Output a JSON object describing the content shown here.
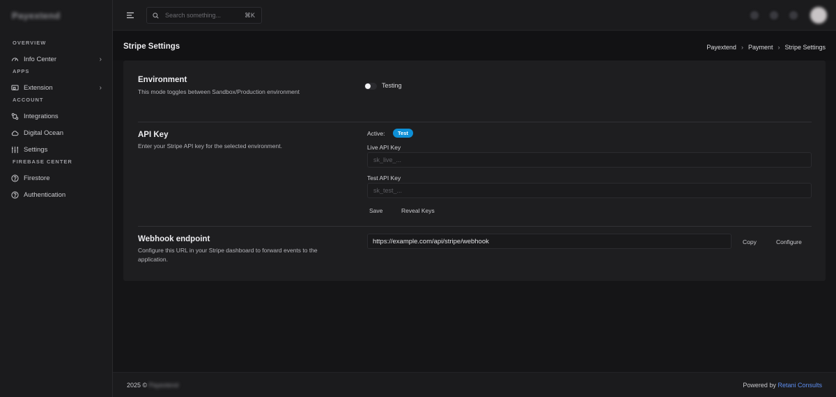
{
  "app": {
    "brand": "Payextend"
  },
  "sidebar": {
    "sections": [
      {
        "title": "OVERVIEW",
        "items": [
          {
            "label": "Info Center",
            "icon": "gauge-icon",
            "chevron": "›"
          }
        ]
      },
      {
        "title": "APPS",
        "items": [
          {
            "label": "Extension",
            "icon": "extension-icon",
            "chevron": "›"
          }
        ]
      },
      {
        "title": "ACCOUNT",
        "items": [
          {
            "label": "Integrations",
            "icon": "integrations-icon"
          },
          {
            "label": "Digital Ocean",
            "icon": "cloud-icon"
          },
          {
            "label": "Settings",
            "icon": "sliders-icon"
          }
        ]
      },
      {
        "title": "FIREBASE CENTER",
        "items": [
          {
            "label": "Firestore",
            "icon": "help-circle-icon"
          },
          {
            "label": "Authentication",
            "icon": "help-circle-icon"
          }
        ]
      }
    ]
  },
  "topbar": {
    "search_placeholder": "Search something...",
    "shortcut": "⌘K"
  },
  "page": {
    "title": "Stripe Settings",
    "breadcrumb": [
      "Payextend",
      "Payment",
      "Stripe Settings"
    ],
    "breadcrumb_separator": "›"
  },
  "environment": {
    "title": "Environment",
    "description": "This mode toggles between Sandbox/Production environment",
    "toggle_label": "Testing",
    "toggle_on": false
  },
  "api_key": {
    "title": "API Key",
    "description": "Enter your Stripe API key for the selected environment.",
    "active_label": "Active:",
    "active_badge": "Test",
    "live_label": "Live API Key",
    "live_placeholder": "sk_live_...",
    "test_label": "Test API Key",
    "test_placeholder": "sk_test_...",
    "save_label": "Save",
    "reveal_label": "Reveal Keys"
  },
  "webhook": {
    "title": "Webhook endpoint",
    "description_line1": "Configure this URL in your Stripe dashboard to forward events to the",
    "description_line2": "application.",
    "url": "https://example.com/api/stripe/webhook",
    "copy_label": "Copy",
    "configure_label": "Configure"
  },
  "footer": {
    "year": "2025 ©",
    "owner": "Payextend",
    "powered_by": "Powered by",
    "company": "Retani Consults"
  },
  "colors": {
    "accent_badge": "#0d8fd6",
    "link": "#5e8ef0",
    "background": "#151517",
    "card": "#1e1e20"
  }
}
